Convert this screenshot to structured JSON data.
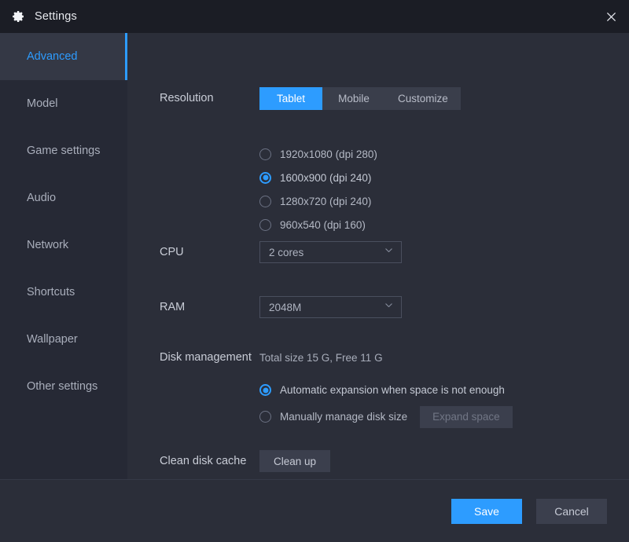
{
  "titlebar": {
    "icon": "gear-icon",
    "title": "Settings",
    "close_icon": "close-icon"
  },
  "sidebar": {
    "items": [
      {
        "label": "Advanced",
        "active": true
      },
      {
        "label": "Model",
        "active": false
      },
      {
        "label": "Game settings",
        "active": false
      },
      {
        "label": "Audio",
        "active": false
      },
      {
        "label": "Network",
        "active": false
      },
      {
        "label": "Shortcuts",
        "active": false
      },
      {
        "label": "Wallpaper",
        "active": false
      },
      {
        "label": "Other settings",
        "active": false
      }
    ]
  },
  "main": {
    "resolution": {
      "label": "Resolution",
      "tabs": [
        {
          "label": "Tablet",
          "active": true
        },
        {
          "label": "Mobile",
          "active": false
        },
        {
          "label": "Customize",
          "active": false
        }
      ],
      "options": [
        {
          "label": "1920x1080  (dpi 280)",
          "selected": false
        },
        {
          "label": "1600x900  (dpi 240)",
          "selected": true
        },
        {
          "label": "1280x720  (dpi 240)",
          "selected": false
        },
        {
          "label": "960x540  (dpi 160)",
          "selected": false
        }
      ]
    },
    "cpu": {
      "label": "CPU",
      "value": "2 cores",
      "chevron_icon": "chevron-down-icon"
    },
    "ram": {
      "label": "RAM",
      "value": "2048M",
      "chevron_icon": "chevron-down-icon"
    },
    "disk": {
      "label": "Disk management",
      "info": "Total size 15 G,  Free 11 G",
      "auto_option": {
        "label": "Automatic expansion when space is not enough",
        "selected": true
      },
      "manual_option": {
        "label": "Manually manage disk size",
        "selected": false
      },
      "expand_button": {
        "label": "Expand space",
        "disabled": true
      }
    },
    "clean_cache": {
      "label": "Clean disk cache",
      "button_label": "Clean up"
    }
  },
  "footer": {
    "save_label": "Save",
    "cancel_label": "Cancel"
  },
  "colors": {
    "accent": "#2d9cff",
    "titlebar_bg": "#1b1d25",
    "sidebar_bg": "#262935",
    "content_bg": "#2b2e39",
    "control_bg": "#3b3f4d"
  }
}
